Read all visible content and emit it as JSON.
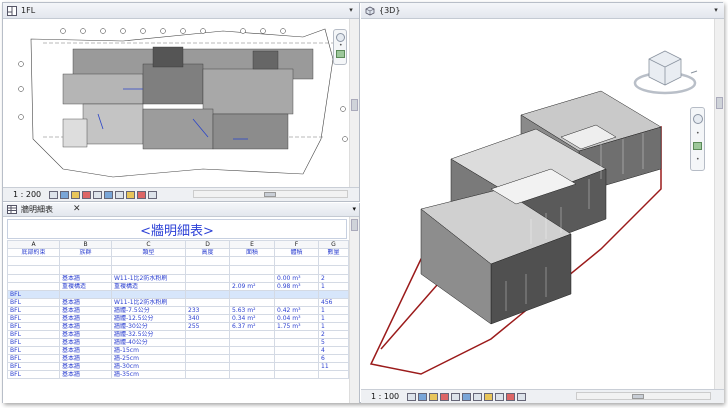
{
  "views": {
    "plan": {
      "title": "1FL",
      "scale": "1 : 200"
    },
    "schedule": {
      "tab": "牆明細表",
      "title": "<牆明細表>"
    },
    "threed": {
      "title": "{3D}",
      "scale": "1 : 100"
    }
  },
  "schedule": {
    "column_letters": [
      "A",
      "B",
      "C",
      "D",
      "E",
      "F",
      "G"
    ],
    "column_headers": [
      "底部約束",
      "族群",
      "類型",
      "高度",
      "面積",
      "體積",
      "數量"
    ],
    "rows": [
      [
        "",
        "基本牆",
        "W11-1比2防水粉刷",
        "",
        "",
        "0.00 m³",
        "2"
      ],
      [
        "",
        "重複構造",
        "重複構造",
        "",
        "2.09 m²",
        "0.98 m³",
        "1"
      ],
      [
        "BFL",
        "",
        "",
        "",
        "",
        "",
        ""
      ],
      [
        "BFL",
        "基本牆",
        "W11-1比2防水粉刷",
        "",
        "",
        "",
        "456"
      ],
      [
        "BFL",
        "基本牆",
        "牆體-7.5公分",
        "233",
        "5.63 m²",
        "0.42 m³",
        "1"
      ],
      [
        "BFL",
        "基本牆",
        "牆體-12.5公分",
        "340",
        "0.34 m²",
        "0.04 m³",
        "1"
      ],
      [
        "BFL",
        "基本牆",
        "牆體-30公分",
        "255",
        "6.37 m²",
        "1.75 m³",
        "1"
      ],
      [
        "BFL",
        "基本牆",
        "牆體-32.5公分",
        "",
        "",
        "",
        "2"
      ],
      [
        "BFL",
        "基本牆",
        "牆體-40公分",
        "",
        "",
        "",
        "5"
      ],
      [
        "BFL",
        "基本牆",
        "牆-15cm",
        "",
        "",
        "",
        "4"
      ],
      [
        "BFL",
        "基本牆",
        "牆-25cm",
        "",
        "",
        "",
        "6"
      ],
      [
        "BFL",
        "基本牆",
        "牆-30cm",
        "",
        "",
        "",
        "11"
      ],
      [
        "BFL",
        "基本牆",
        "牆-35cm",
        "",
        "",
        "",
        ""
      ]
    ]
  },
  "colors": {
    "accent_blue": "#2a3fd6",
    "wall_red": "#9b1b1b"
  }
}
